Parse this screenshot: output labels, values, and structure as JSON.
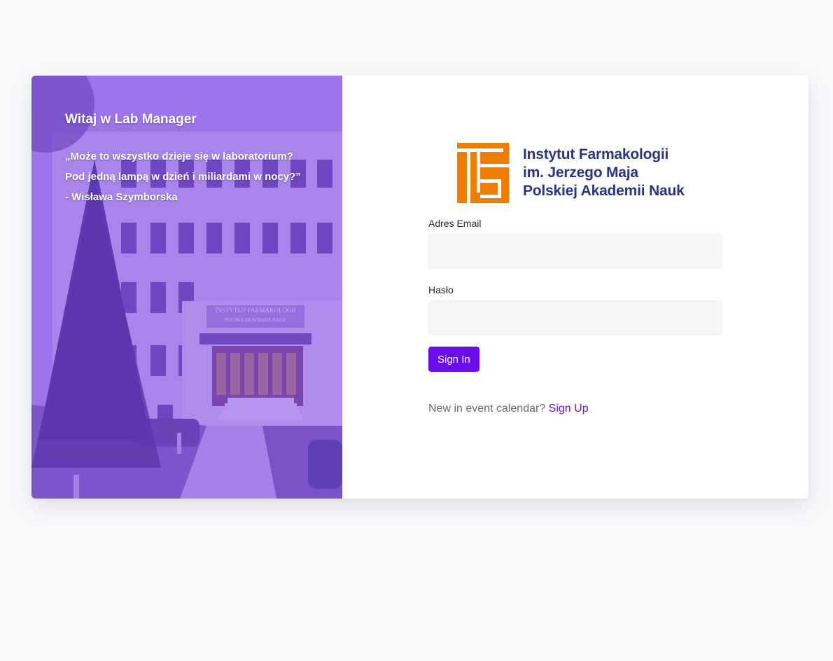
{
  "hero": {
    "welcome": "Witaj w Lab Manager",
    "quote_line1": "„Może to wszystko dzieje się w laboratorium?",
    "quote_line2": "Pod jedną lampą w dzień i miliardami w nocy?”",
    "quote_author": "- Wisława Szymborska",
    "building_sign_line1": "INSTYTUT FARMAKOLOGII",
    "building_sign_line2": "POLSKA AKADEMIA NAUK",
    "overlay_color": "#7a3ce6"
  },
  "logo": {
    "line1": "Instytut Farmakologii",
    "line2": "im. Jerzego Maja",
    "line3": "Polskiej Akademii Nauk",
    "mark_color": "#ef7d00",
    "text_color": "#2b3582"
  },
  "form": {
    "email_label": "Adres Email",
    "email_value": "",
    "password_label": "Hasło",
    "password_value": "",
    "signin_label": "Sign In",
    "signup_prompt": "New in event calendar?",
    "signup_link": "Sign Up",
    "accent_color": "#6a0dec"
  }
}
